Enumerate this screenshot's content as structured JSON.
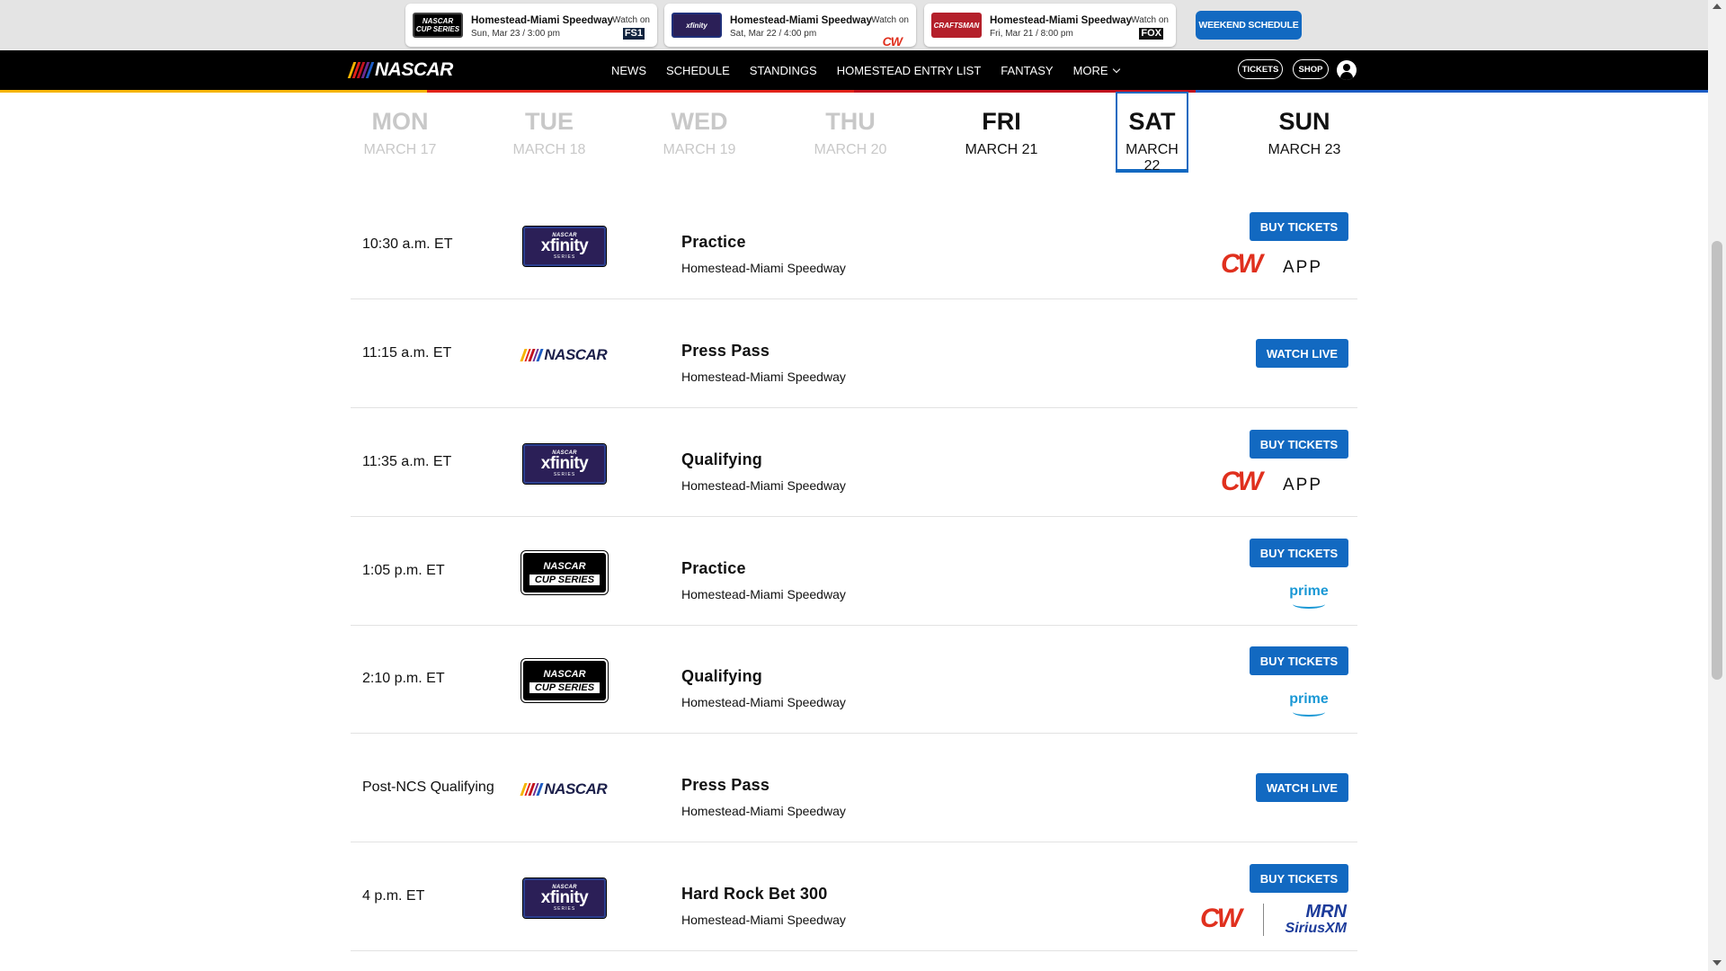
{
  "promos": [
    {
      "series_logo": "NASCAR CUP SERIES",
      "track": "Homestead-Miami Speedway",
      "date": "Sun, Mar 23 / 3:00 pm",
      "watch_label": "Watch on",
      "network": "FS1"
    },
    {
      "series_logo": "xfinity",
      "track": "Homestead-Miami Speedway",
      "date": "Sat, Mar 22 / 4:00 pm",
      "watch_label": "Watch on",
      "network": "CW"
    },
    {
      "series_logo": "CRAFTSMAN",
      "track": "Homestead-Miami Speedway",
      "date": "Fri, Mar 21 / 8:00 pm",
      "watch_label": "Watch on",
      "network": "FOX"
    }
  ],
  "weekend_button": "WEEKEND SCHEDULE",
  "nav": {
    "logo": "NASCAR",
    "links": [
      "NEWS",
      "SCHEDULE",
      "STANDINGS",
      "HOMESTEAD ENTRY LIST",
      "FANTASY",
      "MORE"
    ],
    "tickets": "TICKETS",
    "shop": "SHOP"
  },
  "days": [
    {
      "name": "MON",
      "date": "MARCH 17",
      "state": "past"
    },
    {
      "name": "TUE",
      "date": "MARCH 18",
      "state": "past"
    },
    {
      "name": "WED",
      "date": "MARCH 19",
      "state": "past"
    },
    {
      "name": "THU",
      "date": "MARCH 20",
      "state": "past"
    },
    {
      "name": "FRI",
      "date": "MARCH 21",
      "state": "normal"
    },
    {
      "name": "SAT",
      "date": "MARCH 22",
      "state": "active"
    },
    {
      "name": "SUN",
      "date": "MARCH 23",
      "state": "normal"
    }
  ],
  "events": [
    {
      "time": "10:30 a.m. ET",
      "series": "xfinity",
      "title": "Practice",
      "track": "Homestead-Miami Speedway",
      "button": "BUY TICKETS",
      "broadcast": "CW APP"
    },
    {
      "time": "11:15 a.m. ET",
      "series": "nascar",
      "title": "Press Pass",
      "track": "Homestead-Miami Speedway",
      "button": "WATCH LIVE",
      "broadcast": ""
    },
    {
      "time": "11:35 a.m. ET",
      "series": "xfinity",
      "title": "Qualifying",
      "track": "Homestead-Miami Speedway",
      "button": "BUY TICKETS",
      "broadcast": "CW APP"
    },
    {
      "time": "1:05 p.m. ET",
      "series": "cup",
      "title": "Practice",
      "track": "Homestead-Miami Speedway",
      "button": "BUY TICKETS",
      "broadcast": "prime"
    },
    {
      "time": "2:10 p.m. ET",
      "series": "cup",
      "title": "Qualifying",
      "track": "Homestead-Miami Speedway",
      "button": "BUY TICKETS",
      "broadcast": "prime"
    },
    {
      "time": "Post-NCS Qualifying",
      "series": "nascar",
      "title": "Press Pass",
      "track": "Homestead-Miami Speedway",
      "button": "WATCH LIVE",
      "broadcast": ""
    },
    {
      "time": "4 p.m. ET",
      "series": "xfinity",
      "title": "Hard Rock Bet 300",
      "track": "Homestead-Miami Speedway",
      "button": "BUY TICKETS",
      "broadcast": "CW | MRN SiriusXM"
    }
  ],
  "logo_text": {
    "nascar_small": "NASCAR",
    "xfinity": "xfinity",
    "series": "SERIES",
    "cup_nascar": "NASCAR",
    "cup": "CUP SERIES",
    "cw": "CW",
    "app": "APP",
    "prime": "prime",
    "mrn": "MRN",
    "siriusxm": "SiriusXM"
  },
  "colors": {
    "accent": "#1269c1",
    "cw_red": "#e0301e",
    "prime_blue": "#1a98d5",
    "xfinity_purple": "#2b1f57"
  }
}
